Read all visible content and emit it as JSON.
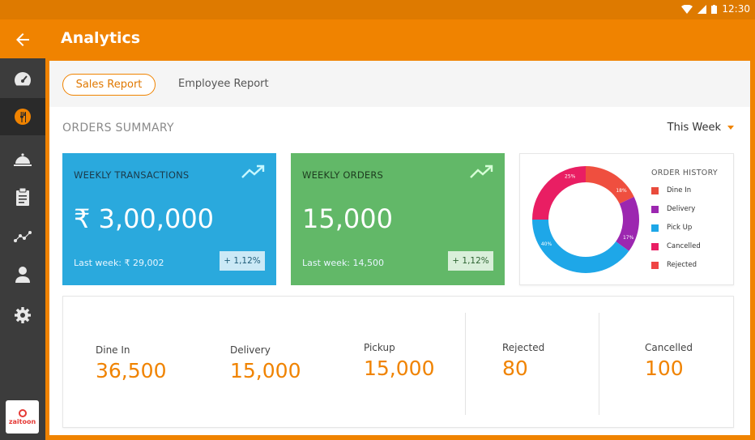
{
  "status": {
    "time": "12:30"
  },
  "appbar": {
    "title": "Analytics",
    "back_icon": "arrow-left-icon"
  },
  "sidebar": {
    "items": [
      {
        "icon": "dashboard-gauge-icon",
        "active": false
      },
      {
        "icon": "restaurant-icon",
        "active": true
      },
      {
        "icon": "food-cloche-icon",
        "active": false
      },
      {
        "icon": "clipboard-icon",
        "active": false
      },
      {
        "icon": "analytics-graph-icon",
        "active": false
      },
      {
        "icon": "user-icon",
        "active": false
      },
      {
        "icon": "settings-gear-icon",
        "active": false
      }
    ],
    "logo_text": "zaitoon"
  },
  "tabs": [
    {
      "label": "Sales Report",
      "active": true
    },
    {
      "label": "Employee Report",
      "active": false
    }
  ],
  "summary": {
    "title": "ORDERS SUMMARY",
    "period": "This Week"
  },
  "cards": {
    "transactions": {
      "title": "WEEKLY TRANSACTIONS",
      "value": "₹ 3,00,000",
      "last_week": "Last week: ₹ 29,002",
      "change": "+ 1,12%"
    },
    "orders": {
      "title": "WEEKLY ORDERS",
      "value": "15,000",
      "last_week": "Last week: 14,500",
      "change": "+ 1,12%"
    }
  },
  "order_history": {
    "title": "ORDER HISTORY",
    "legend": [
      {
        "label": "Dine In",
        "color": "#e94b3c"
      },
      {
        "label": "Delivery",
        "color": "#9c27b0"
      },
      {
        "label": "Pick Up",
        "color": "#1ea7e8"
      },
      {
        "label": "Cancelled",
        "color": "#e91e63"
      },
      {
        "label": "Rejected",
        "color": "#ef4444"
      }
    ],
    "slices": [
      {
        "label": "18%",
        "value": 18,
        "color": "#ef4f3f"
      },
      {
        "label": "17%",
        "value": 17,
        "color": "#9c27b0"
      },
      {
        "label": "40%",
        "value": 40,
        "color": "#1ea7e8"
      },
      {
        "label": "25%",
        "value": 25,
        "color": "#e91e63"
      }
    ]
  },
  "stats": [
    {
      "label": "Dine In",
      "value": "36,500"
    },
    {
      "label": "Delivery",
      "value": "15,000"
    },
    {
      "label": "Pickup",
      "value": "15,000"
    },
    {
      "label": "Rejected",
      "value": "80"
    },
    {
      "label": "Cancelled",
      "value": "100"
    }
  ]
}
